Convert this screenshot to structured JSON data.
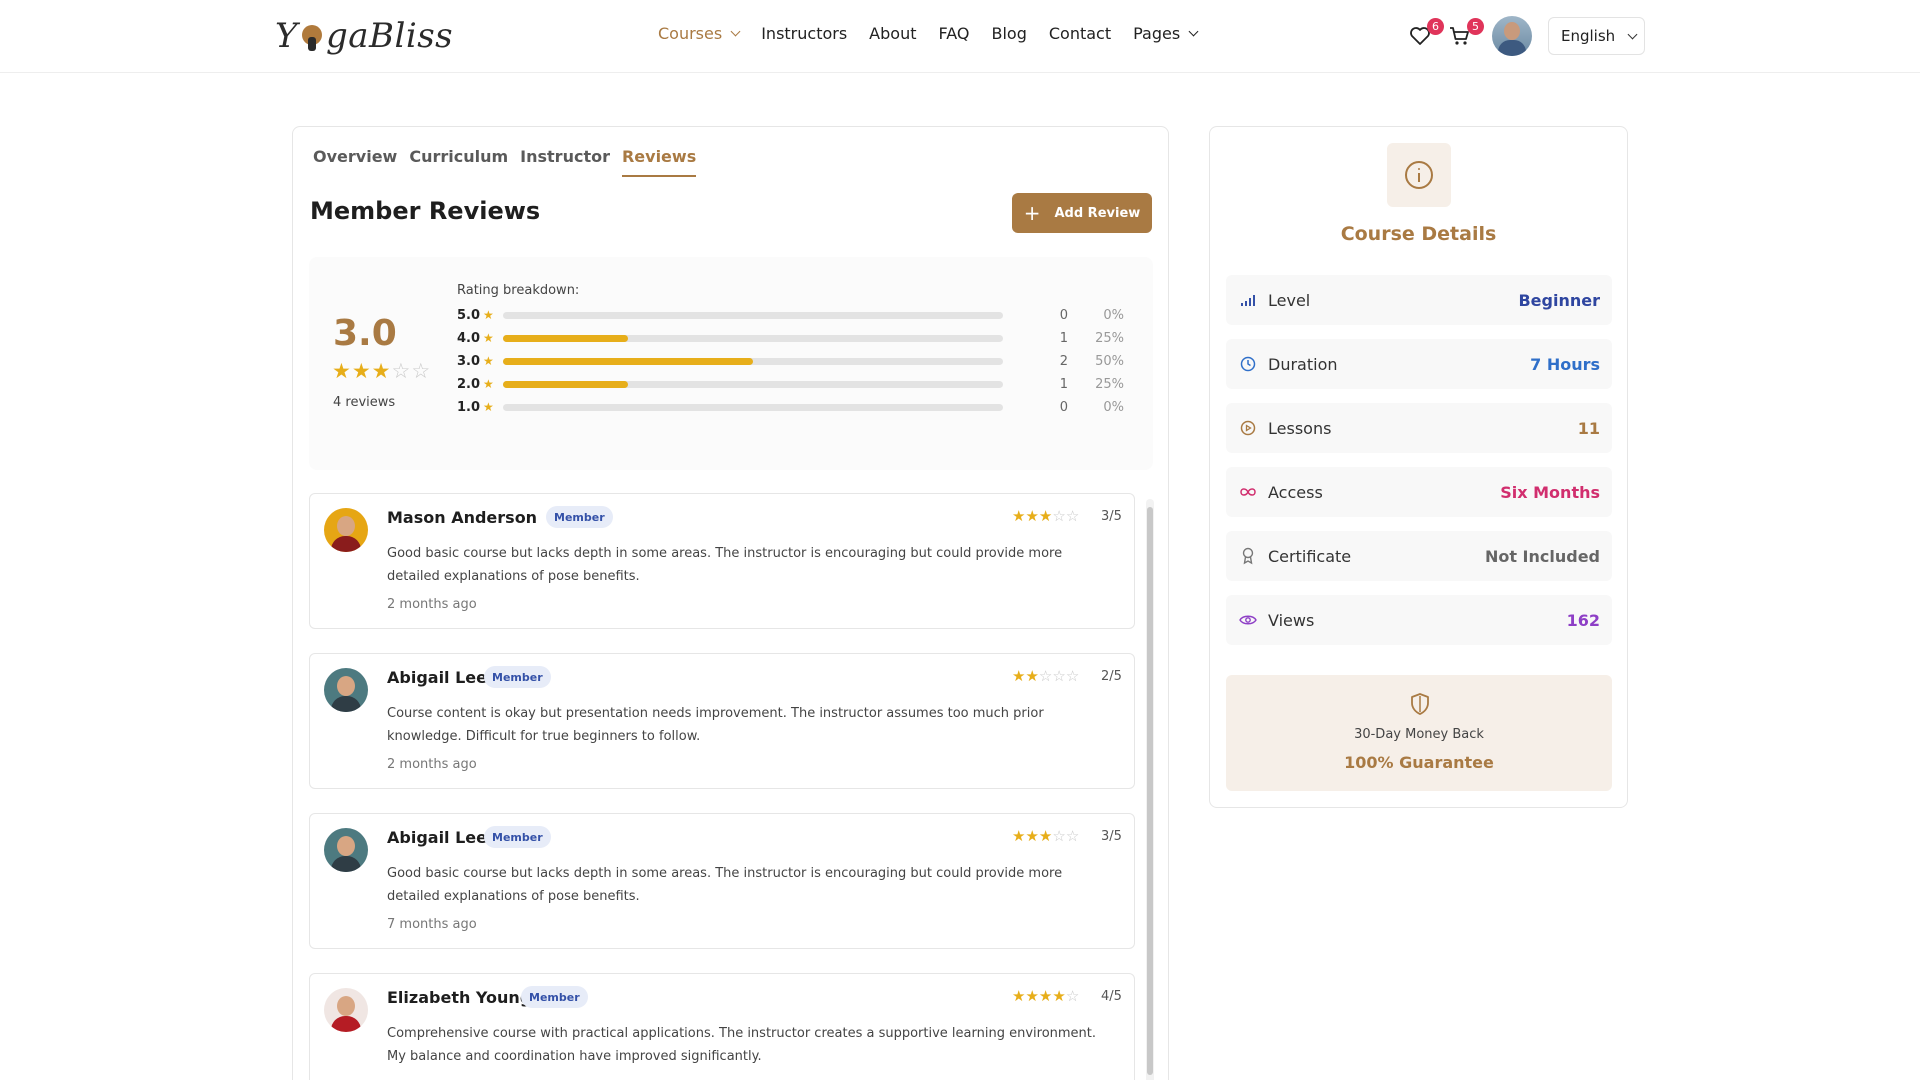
{
  "brand": {
    "logo_text_pre": "Y",
    "logo_text_post": "gaBliss"
  },
  "nav": {
    "items": [
      {
        "label": "Courses",
        "active": true,
        "dropdown": true
      },
      {
        "label": "Instructors"
      },
      {
        "label": "About"
      },
      {
        "label": "FAQ"
      },
      {
        "label": "Blog"
      },
      {
        "label": "Contact"
      },
      {
        "label": "Pages",
        "dropdown": true
      }
    ]
  },
  "header": {
    "wishlist_count": "6",
    "cart_count": "5",
    "language": "English"
  },
  "tabs": [
    {
      "label": "Overview"
    },
    {
      "label": "Curriculum"
    },
    {
      "label": "Instructor"
    },
    {
      "label": "Reviews",
      "active": true
    }
  ],
  "reviews_section": {
    "title": "Member Reviews",
    "add_review_label": "Add Review",
    "average": "3.0",
    "average_stars": 3,
    "count_label": "4 reviews",
    "breakdown_label": "Rating breakdown:",
    "breakdown": [
      {
        "level": "5.0",
        "count": "0",
        "percent": "0%",
        "fraction": 0
      },
      {
        "level": "4.0",
        "count": "1",
        "percent": "25%",
        "fraction": 0.25
      },
      {
        "level": "3.0",
        "count": "2",
        "percent": "50%",
        "fraction": 0.5
      },
      {
        "level": "2.0",
        "count": "1",
        "percent": "25%",
        "fraction": 0.25
      },
      {
        "level": "1.0",
        "count": "0",
        "percent": "0%",
        "fraction": 0
      }
    ]
  },
  "reviews": [
    {
      "name": "Mason Anderson",
      "role": "Member",
      "rating": 3,
      "score": "3/5",
      "text": "Good basic course but lacks depth in some areas. The instructor is encouraging but could provide more detailed explanations of pose benefits.",
      "time": "2 months ago"
    },
    {
      "name": "Abigail Lee",
      "role": "Member",
      "rating": 2,
      "score": "2/5",
      "text": "Course content is okay but presentation needs improvement. The instructor assumes too much prior knowledge. Difficult for true beginners to follow.",
      "time": "2 months ago"
    },
    {
      "name": "Abigail Lee",
      "role": "Member",
      "rating": 3,
      "score": "3/5",
      "text": "Good basic course but lacks depth in some areas. The instructor is encouraging but could provide more detailed explanations of pose benefits.",
      "time": "7 months ago"
    },
    {
      "name": "Elizabeth Young",
      "role": "Member",
      "rating": 4,
      "score": "4/5",
      "text": "Comprehensive course with practical applications. The instructor creates a supportive learning environment. My balance and coordination have improved significantly.",
      "time": ""
    }
  ],
  "course_details": {
    "title": "Course Details",
    "rows": [
      {
        "icon": "signal-bars-icon",
        "label": "Level",
        "value": "Beginner",
        "color": "#2f46a0"
      },
      {
        "icon": "clock-icon",
        "label": "Duration",
        "value": "7 Hours",
        "color": "#2f6fc9"
      },
      {
        "icon": "play-circle-icon",
        "label": "Lessons",
        "value": "11",
        "color": "#a97a43"
      },
      {
        "icon": "infinity-icon",
        "label": "Access",
        "value": "Six Months",
        "color": "#d12e6e"
      },
      {
        "icon": "award-icon",
        "label": "Certificate",
        "value": "Not Included",
        "color": "#666666"
      },
      {
        "icon": "eye-icon",
        "label": "Views",
        "value": "162",
        "color": "#8e3fc6"
      }
    ],
    "guarantee_line1": "30-Day Money Back",
    "guarantee_line2": "100% Guarantee"
  },
  "colors": {
    "accent": "#a97a43",
    "star": "#e7ae1a",
    "badge": "#e0345a"
  }
}
